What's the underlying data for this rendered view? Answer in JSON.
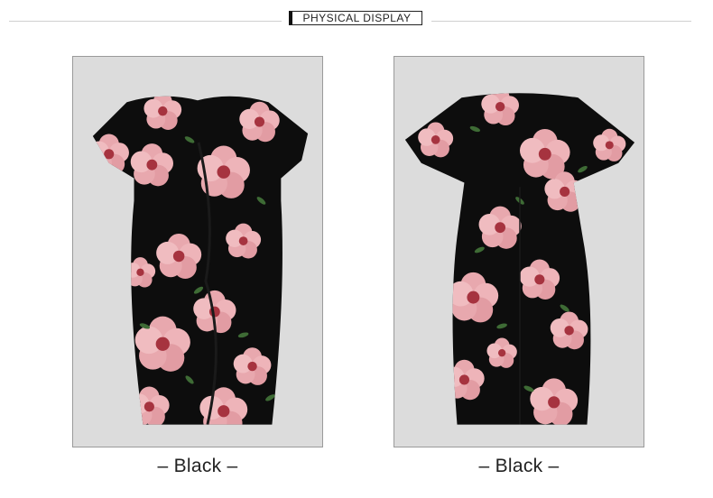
{
  "header": {
    "title": "PHYSICAL DISPLAY"
  },
  "panels": [
    {
      "view": "front",
      "caption": "– Black –"
    },
    {
      "view": "back",
      "caption": "– Black –"
    }
  ],
  "colors": {
    "dress": "#0d0d0d",
    "flower": "#e8a8ae",
    "flower_center": "#a6333f",
    "leaf": "#3e6b35",
    "panel_bg": "#dcdcdc"
  },
  "icons": [
    "dress-front-image",
    "dress-back-image"
  ]
}
